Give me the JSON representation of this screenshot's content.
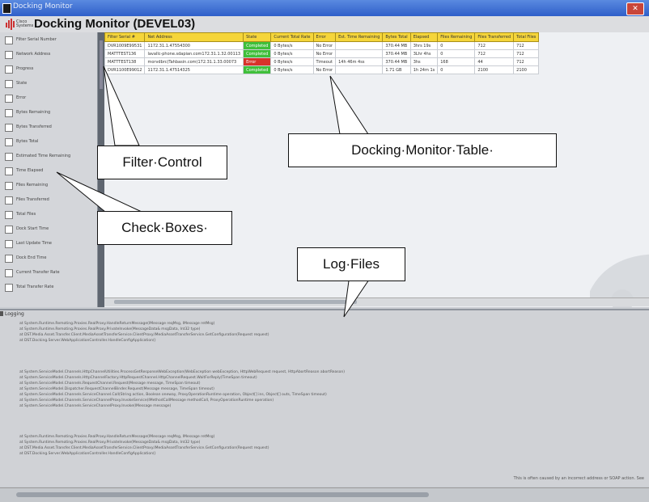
{
  "window": {
    "title": "Docking Monitor"
  },
  "app": {
    "logo_text": "Cisco Systems",
    "title": "Docking Monitor (DEVEL03)"
  },
  "filters": [
    "Filter Serial Number",
    "Network Address",
    "Progress",
    "State",
    "Error",
    "Bytes Remaining",
    "Bytes Transferred",
    "Bytes Total",
    "Estimated Time Remaining",
    "Time Elapsed",
    "Files Remaining",
    "Files Transferred",
    "Total Files",
    "Dock Start Time",
    "Last Update Time",
    "Dock End Time",
    "Current Transfer Rate",
    "Total Transfer Rate"
  ],
  "table": {
    "columns": [
      "Filter Serial #",
      "Net Address",
      "State",
      "Current Total Rate",
      "Error",
      "Est. Time Remaining",
      "Bytes Total",
      "Elapsed",
      "Files Remaining",
      "Files Transferred",
      "Total Files"
    ],
    "rows": [
      [
        "DVR1009E99531",
        "1172.31.1.47554300",
        "Completed",
        "0 Bytes/s",
        "No Error",
        "",
        "370.44 MB",
        "3hrs 19s",
        "0",
        "712",
        "712"
      ],
      [
        "MATTTEST136",
        "lavallc-phone.sdapian.com172.31.1.32.00113",
        "Completed",
        "0 Bytes/s",
        "No Error",
        "",
        "370.44 MB",
        "3Lhr 4hs",
        "0",
        "712",
        "712"
      ],
      [
        "MATTTEST138",
        "morvdbrc(Tahbasin.com)172.31.1.33.00073",
        "Error",
        "0 Bytes/s",
        "Timeout",
        "14h 46m 4ss",
        "370.44 MB",
        "3hs",
        "168",
        "44",
        "712"
      ],
      [
        "DVR1100E99012",
        "1172.31.1.47514325",
        "Completed",
        "0 Bytes/s",
        "No Error",
        "",
        "1.71 GB",
        "1h 24m 1s",
        "0",
        "2100",
        "2100"
      ]
    ]
  },
  "log": {
    "header": "Logging",
    "lines": [
      "at System.Runtime.Remoting.Proxies.RealProxy.HandleReturnMessage(IMessage reqMsg, IMessage retMsg)",
      "at System.Runtime.Remoting.Proxies.RealProxy.PrivateInvoke(MessageData& msgData, Int32 type)",
      "at DST.Media.Asset.Transfer.Client.MediaAssetTransferService.ClientProxy.IMediaAssetTransferService.GetConfiguration(Request request)",
      "at DST.Docking.Server.WebApplicationController.HandleConfigApplication()",
      "at System.ServiceModel.Channels.HttpChannelUtilities.ProcessGetResponseWebException(WebException webException, HttpWebRequest request, HttpAbortReason abortReason)",
      "at System.ServiceModel.Channels.HttpChannelFactory.HttpRequestChannel.HttpChannelRequest.WaitForReply(TimeSpan timeout)",
      "at System.ServiceModel.Channels.RequestChannel.Request(Message message, TimeSpan timeout)",
      "at System.ServiceModel.Dispatcher.RequestChannelBinder.Request(Message message, TimeSpan timeout)",
      "at System.ServiceModel.Channels.ServiceChannel.Call(String action, Boolean oneway, ProxyOperationRuntime operation, Object[] ins, Object[] outs, TimeSpan timeout)",
      "at System.ServiceModel.Channels.ServiceChannelProxy.InvokeService(IMethodCallMessage methodCall, ProxyOperationRuntime operation)",
      "at System.ServiceModel.Channels.ServiceChannelProxy.Invoke(IMessage message)",
      "at System.Runtime.Remoting.Proxies.RealProxy.HandleReturnMessage(IMessage reqMsg, IMessage retMsg)",
      "at System.Runtime.Remoting.Proxies.RealProxy.PrivateInvoke(MessageData& msgData, Int32 type)",
      "at DST.Media.Asset.Transfer.Client.MediaAssetTransferService.ClientProxy.IMediaAssetTransferService.GetConfiguration(Request request)",
      "at DST.Docking.Server.WebApplicationController.HandleConfigApplication()"
    ],
    "message": "This is often caused by an incorrect address or SOAP action. See"
  },
  "callouts": {
    "filter_control": "Filter·Control",
    "docking_table": "Docking·Monitor·Table·",
    "check_boxes": "Check·Boxes·",
    "log_files": "Log·Files"
  },
  "colors": {
    "header_yellow": "#f5d53a",
    "status_ok": "#3fbf3a",
    "status_error": "#d8322a",
    "titlebar": "#2f5fc9"
  }
}
